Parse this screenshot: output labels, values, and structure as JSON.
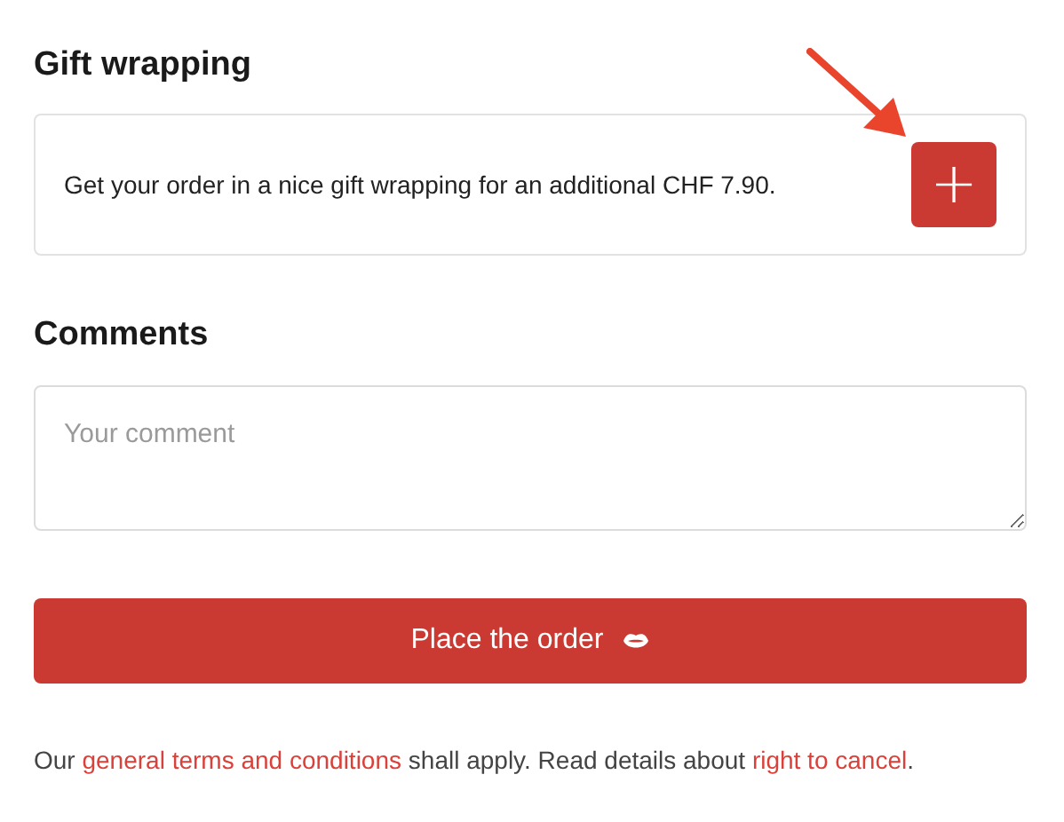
{
  "gift_wrapping": {
    "heading": "Gift wrapping",
    "description": "Get your order in a nice gift wrapping for an additional CHF 7.90.",
    "add_button": "+"
  },
  "comments": {
    "heading": "Comments",
    "placeholder": "Your comment"
  },
  "order_button": {
    "label": "Place the order"
  },
  "footer": [
    {
      "kind": "text",
      "text": "Our "
    },
    {
      "kind": "link",
      "text": "general terms and conditions"
    },
    {
      "kind": "text",
      "text": " shall apply. Read details about "
    },
    {
      "kind": "link",
      "text": "right to cancel"
    },
    {
      "kind": "text",
      "text": "."
    }
  ]
}
